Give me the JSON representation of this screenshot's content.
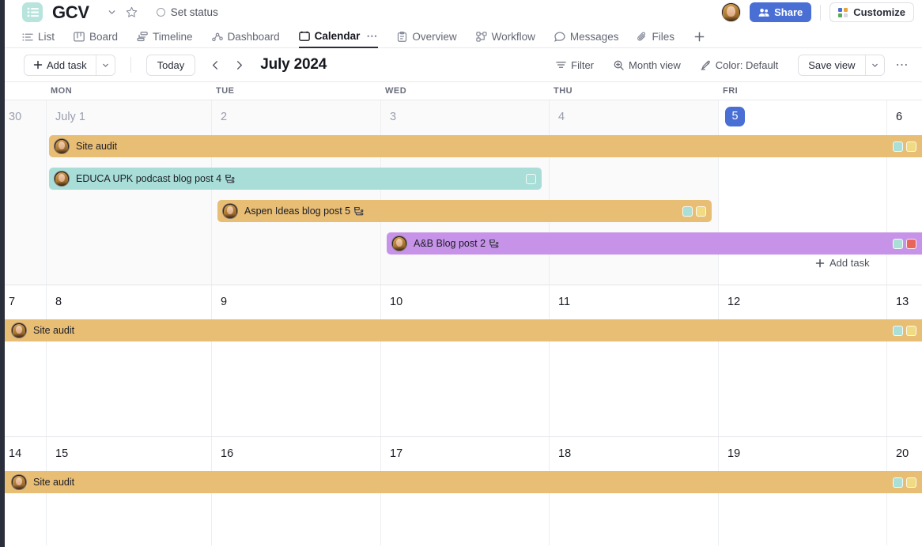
{
  "header": {
    "logo_icon": "list-logo-icon",
    "logo_color": "#b7e4dd",
    "space_name": "GCV",
    "chevron_icon": "chevron-down-icon",
    "star_icon": "star-icon",
    "status_label": "Set status",
    "avatar_label": "user-avatar",
    "share_label": "Share",
    "share_color": "#4a6fd4",
    "customize_label": "Customize"
  },
  "tabs": [
    {
      "label": "List",
      "icon": "list-icon",
      "active": false
    },
    {
      "label": "Board",
      "icon": "board-icon",
      "active": false
    },
    {
      "label": "Timeline",
      "icon": "timeline-icon",
      "active": false
    },
    {
      "label": "Dashboard",
      "icon": "dashboard-icon",
      "active": false
    },
    {
      "label": "Calendar",
      "icon": "calendar-icon",
      "active": true
    },
    {
      "label": "Overview",
      "icon": "overview-icon",
      "active": false
    },
    {
      "label": "Workflow",
      "icon": "workflow-icon",
      "active": false
    },
    {
      "label": "Messages",
      "icon": "messages-icon",
      "active": false
    },
    {
      "label": "Files",
      "icon": "files-icon",
      "active": false
    }
  ],
  "tab_more_dots": "⋯",
  "tab_add_icon": "plus-icon",
  "toolbar": {
    "add_task_label": "Add task",
    "add_task_caret_icon": "chevron-down-icon",
    "today_label": "Today",
    "prev_icon": "chevron-left-icon",
    "next_icon": "chevron-right-icon",
    "month_title": "July 2024",
    "filter_label": "Filter",
    "filter_icon": "filter-icon",
    "month_view_label": "Month view",
    "month_view_icon": "zoom-icon",
    "color_label": "Color: Default",
    "color_icon": "paint-icon",
    "save_view_label": "Save view",
    "save_view_caret_icon": "chevron-down-icon",
    "more_dots": "⋯"
  },
  "calendar": {
    "weekdays": [
      "MON",
      "TUE",
      "WED",
      "THU",
      "FRI"
    ],
    "add_task_inline_label": "Add task",
    "weeks": [
      {
        "days": [
          {
            "num": "30",
            "dim": true,
            "today": false,
            "muted": true
          },
          {
            "num": "July 1",
            "dim": true,
            "today": false,
            "muted": true
          },
          {
            "num": "2",
            "dim": true,
            "today": false,
            "muted": true
          },
          {
            "num": "3",
            "dim": true,
            "today": false,
            "muted": true
          },
          {
            "num": "4",
            "dim": true,
            "today": false,
            "muted": true
          },
          {
            "num": "5",
            "dim": false,
            "today": true,
            "muted": false
          },
          {
            "num": "6",
            "dim": false,
            "today": false,
            "muted": false
          }
        ]
      },
      {
        "days": [
          {
            "num": "7",
            "dim": false,
            "today": false,
            "muted": false
          },
          {
            "num": "8",
            "dim": false,
            "today": false,
            "muted": false
          },
          {
            "num": "9",
            "dim": false,
            "today": false,
            "muted": false
          },
          {
            "num": "10",
            "dim": false,
            "today": false,
            "muted": false
          },
          {
            "num": "11",
            "dim": false,
            "today": false,
            "muted": false
          },
          {
            "num": "12",
            "dim": false,
            "today": false,
            "muted": false
          },
          {
            "num": "13",
            "dim": false,
            "today": false,
            "muted": false
          }
        ]
      },
      {
        "days": [
          {
            "num": "14",
            "dim": false,
            "today": false,
            "muted": false
          },
          {
            "num": "15",
            "dim": false,
            "today": false,
            "muted": false
          },
          {
            "num": "16",
            "dim": false,
            "today": false,
            "muted": false
          },
          {
            "num": "17",
            "dim": false,
            "today": false,
            "muted": false
          },
          {
            "num": "18",
            "dim": false,
            "today": false,
            "muted": false
          },
          {
            "num": "19",
            "dim": false,
            "today": false,
            "muted": false
          },
          {
            "num": "20",
            "dim": false,
            "today": false,
            "muted": false
          }
        ]
      }
    ],
    "tasks": [
      {
        "id": "site-audit-w1",
        "title": "Site audit",
        "color": "#e8bd74",
        "has_subtask_icon": false,
        "badges": [
          "#aadfd8",
          "#f0da82"
        ],
        "avatar": true
      },
      {
        "id": "educa-upk",
        "title": "EDUCA UPK podcast blog post 4",
        "color": "#a9ded8",
        "has_subtask_icon": true,
        "badges": [
          "#aadfd8"
        ],
        "avatar": true
      },
      {
        "id": "aspen-ideas",
        "title": "Aspen Ideas blog post 5",
        "color": "#e8bd74",
        "has_subtask_icon": true,
        "badges": [
          "#aadfd8",
          "#f0da82"
        ],
        "avatar": true
      },
      {
        "id": "ab-blog-post",
        "title": "A&B Blog post 2",
        "color": "#c793e8",
        "has_subtask_icon": true,
        "badges": [
          "#aadfd8",
          "#e8655c"
        ],
        "avatar": true
      },
      {
        "id": "site-audit-w2",
        "title": "Site audit",
        "color": "#e8bd74",
        "has_subtask_icon": false,
        "badges": [
          "#aadfd8",
          "#f0da82"
        ],
        "avatar": true
      },
      {
        "id": "site-audit-w3",
        "title": "Site audit",
        "color": "#e8bd74",
        "has_subtask_icon": false,
        "badges": [
          "#aadfd8",
          "#f0da82"
        ],
        "avatar": true
      }
    ]
  }
}
